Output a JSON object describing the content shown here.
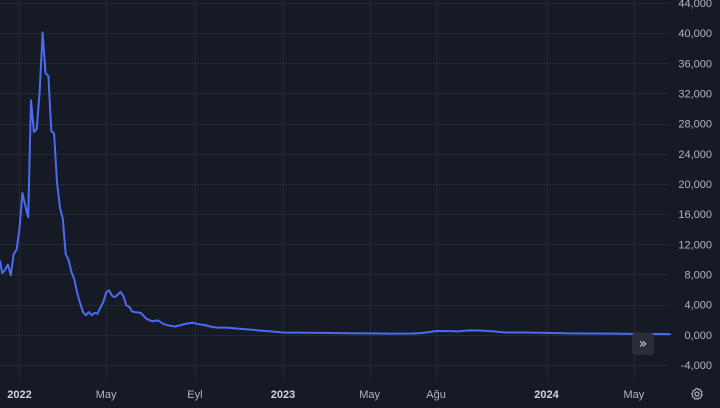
{
  "chart_data": {
    "type": "line",
    "title": "",
    "xlabel": "",
    "ylabel": "",
    "x_range": [
      "2021-12-05",
      "2024-06-20"
    ],
    "ylim": [
      -6000,
      44400
    ],
    "grid": true,
    "y_ticks": [
      {
        "value": 44000,
        "label": "44,000"
      },
      {
        "value": 40000,
        "label": "40,000"
      },
      {
        "value": 36000,
        "label": "36,000"
      },
      {
        "value": 32000,
        "label": "32,000"
      },
      {
        "value": 28000,
        "label": "28,000"
      },
      {
        "value": 24000,
        "label": "24,000"
      },
      {
        "value": 20000,
        "label": "20,000"
      },
      {
        "value": 16000,
        "label": "16,000"
      },
      {
        "value": 12000,
        "label": "12,000"
      },
      {
        "value": 8000,
        "label": "8,000"
      },
      {
        "value": 4000,
        "label": "4,000"
      },
      {
        "value": 0,
        "label": "0,000"
      },
      {
        "value": -4000,
        "label": "-4,000"
      }
    ],
    "x_ticks": [
      {
        "date": "2022-01-01",
        "label": "2022",
        "bold": true
      },
      {
        "date": "2022-05-01",
        "label": "May",
        "bold": false
      },
      {
        "date": "2022-09-01",
        "label": "Eyl",
        "bold": false
      },
      {
        "date": "2023-01-01",
        "label": "2023",
        "bold": true
      },
      {
        "date": "2023-05-01",
        "label": "May",
        "bold": false
      },
      {
        "date": "2023-08-01",
        "label": "Ağu",
        "bold": false
      },
      {
        "date": "2024-01-01",
        "label": "2024",
        "bold": true
      },
      {
        "date": "2024-05-01",
        "label": "May",
        "bold": false
      }
    ],
    "series": [
      {
        "color": "#4a6cf2",
        "points": [
          [
            "2021-12-05",
            9800
          ],
          [
            "2021-12-08",
            8200
          ],
          [
            "2021-12-12",
            8600
          ],
          [
            "2021-12-16",
            9300
          ],
          [
            "2021-12-20",
            7900
          ],
          [
            "2021-12-24",
            10700
          ],
          [
            "2021-12-28",
            11300
          ],
          [
            "2022-01-01",
            14100
          ],
          [
            "2022-01-05",
            18800
          ],
          [
            "2022-01-09",
            17100
          ],
          [
            "2022-01-13",
            15600
          ],
          [
            "2022-01-17",
            31100
          ],
          [
            "2022-01-21",
            26900
          ],
          [
            "2022-01-25",
            27300
          ],
          [
            "2022-01-29",
            32300
          ],
          [
            "2022-02-02",
            40100
          ],
          [
            "2022-02-06",
            34700
          ],
          [
            "2022-02-10",
            34300
          ],
          [
            "2022-02-14",
            27000
          ],
          [
            "2022-02-18",
            26700
          ],
          [
            "2022-02-22",
            20200
          ],
          [
            "2022-02-26",
            16900
          ],
          [
            "2022-03-02",
            15400
          ],
          [
            "2022-03-06",
            10700
          ],
          [
            "2022-03-10",
            9900
          ],
          [
            "2022-03-14",
            8300
          ],
          [
            "2022-03-18",
            7300
          ],
          [
            "2022-03-22",
            5500
          ],
          [
            "2022-03-26",
            4200
          ],
          [
            "2022-03-30",
            3000
          ],
          [
            "2022-04-03",
            2600
          ],
          [
            "2022-04-07",
            3000
          ],
          [
            "2022-04-11",
            2600
          ],
          [
            "2022-04-15",
            2900
          ],
          [
            "2022-04-19",
            2800
          ],
          [
            "2022-04-23",
            3600
          ],
          [
            "2022-04-27",
            4300
          ],
          [
            "2022-05-01",
            5600
          ],
          [
            "2022-05-05",
            5900
          ],
          [
            "2022-05-09",
            5200
          ],
          [
            "2022-05-13",
            5000
          ],
          [
            "2022-05-17",
            5300
          ],
          [
            "2022-05-21",
            5700
          ],
          [
            "2022-05-25",
            5100
          ],
          [
            "2022-05-29",
            3900
          ],
          [
            "2022-06-02",
            3700
          ],
          [
            "2022-06-06",
            3100
          ],
          [
            "2022-06-10",
            3000
          ],
          [
            "2022-06-18",
            2900
          ],
          [
            "2022-06-26",
            2100
          ],
          [
            "2022-07-04",
            1800
          ],
          [
            "2022-07-12",
            1900
          ],
          [
            "2022-07-20",
            1400
          ],
          [
            "2022-07-28",
            1200
          ],
          [
            "2022-08-05",
            1100
          ],
          [
            "2022-08-13",
            1300
          ],
          [
            "2022-08-21",
            1500
          ],
          [
            "2022-08-29",
            1600
          ],
          [
            "2022-09-06",
            1400
          ],
          [
            "2022-09-14",
            1300
          ],
          [
            "2022-09-22",
            1100
          ],
          [
            "2022-10-01",
            950
          ],
          [
            "2022-10-15",
            950
          ],
          [
            "2022-11-01",
            800
          ],
          [
            "2022-11-15",
            700
          ],
          [
            "2022-12-01",
            550
          ],
          [
            "2022-12-15",
            450
          ],
          [
            "2023-01-01",
            300
          ],
          [
            "2023-02-01",
            280
          ],
          [
            "2023-03-01",
            250
          ],
          [
            "2023-04-01",
            200
          ],
          [
            "2023-05-01",
            180
          ],
          [
            "2023-06-01",
            150
          ],
          [
            "2023-07-01",
            170
          ],
          [
            "2023-07-15",
            250
          ],
          [
            "2023-08-01",
            500
          ],
          [
            "2023-08-20",
            480
          ],
          [
            "2023-09-01",
            450
          ],
          [
            "2023-09-15",
            580
          ],
          [
            "2023-10-01",
            560
          ],
          [
            "2023-10-20",
            450
          ],
          [
            "2023-11-05",
            300
          ],
          [
            "2023-12-01",
            300
          ],
          [
            "2024-01-01",
            250
          ],
          [
            "2024-02-01",
            180
          ],
          [
            "2024-03-01",
            170
          ],
          [
            "2024-04-01",
            150
          ],
          [
            "2024-05-01",
            120
          ],
          [
            "2024-06-01",
            100
          ],
          [
            "2024-06-20",
            90
          ]
        ]
      }
    ]
  },
  "controls": {
    "scroll_glyph": "»",
    "scroll_icon": "double-chevron-right-icon",
    "settings_icon": "gear-icon"
  }
}
